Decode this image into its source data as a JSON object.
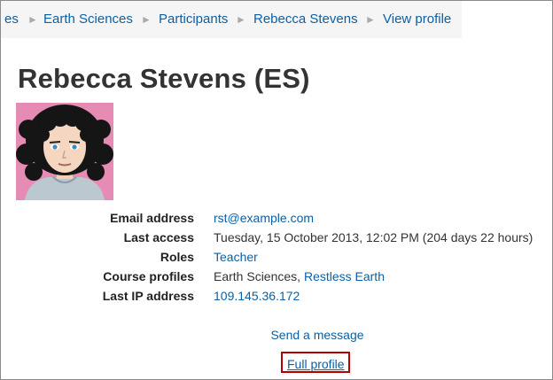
{
  "breadcrumb": {
    "items": [
      "es",
      "Earth Sciences",
      "Participants",
      "Rebecca Stevens",
      "View profile"
    ],
    "separator": "►"
  },
  "profile": {
    "title": "Rebecca Stevens (ES)",
    "avatar_icon": "user-avatar-cartoon-icon"
  },
  "details": {
    "email": {
      "label": "Email address",
      "value": "rst@example.com"
    },
    "last_access": {
      "label": "Last access",
      "value": "Tuesday, 15 October 2013, 12:02 PM  (204 days 22 hours)"
    },
    "roles": {
      "label": "Roles",
      "value": "Teacher"
    },
    "course_profiles": {
      "label": "Course profiles",
      "course1": "Earth Sciences",
      "comma": ", ",
      "course2": "Restless Earth"
    },
    "last_ip": {
      "label": "Last IP address",
      "value": "109.145.36.172"
    }
  },
  "actions": {
    "send_message": "Send a message",
    "full_profile": "Full profile"
  },
  "colors": {
    "link": "#0b60a5",
    "highlight_border": "#b30000",
    "breadcrumb_bg": "#f5f5f5"
  }
}
